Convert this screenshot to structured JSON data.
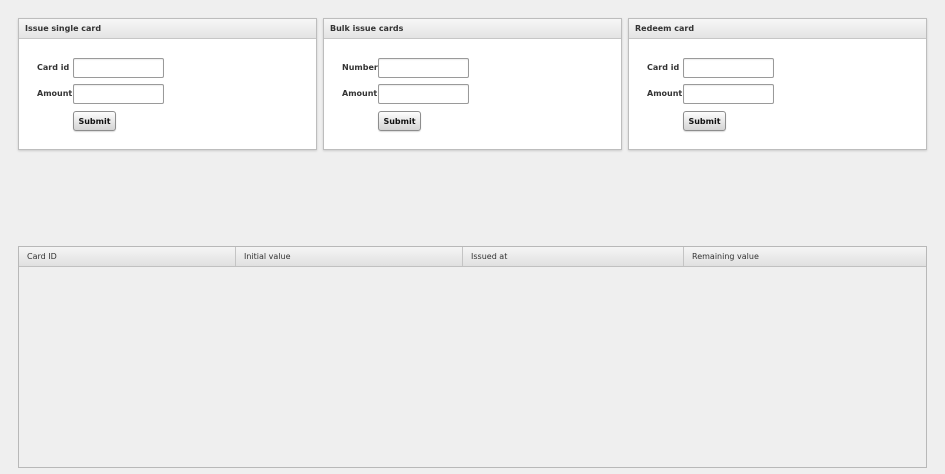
{
  "panels": [
    {
      "title": "Issue single card",
      "fields": [
        {
          "label": "Card id",
          "value": "",
          "placeholder": ""
        },
        {
          "label": "Amount",
          "value": "",
          "placeholder": ""
        }
      ],
      "submit_label": "Submit"
    },
    {
      "title": "Bulk issue cards",
      "fields": [
        {
          "label": "Number",
          "value": "",
          "placeholder": ""
        },
        {
          "label": "Amount",
          "value": "",
          "placeholder": ""
        }
      ],
      "submit_label": "Submit"
    },
    {
      "title": "Redeem card",
      "fields": [
        {
          "label": "Card id",
          "value": "",
          "placeholder": ""
        },
        {
          "label": "Amount",
          "value": "",
          "placeholder": ""
        }
      ],
      "submit_label": "Submit"
    }
  ],
  "grid": {
    "columns": [
      "Card ID",
      "Initial value",
      "Issued at",
      "Remaining value"
    ],
    "rows": []
  }
}
